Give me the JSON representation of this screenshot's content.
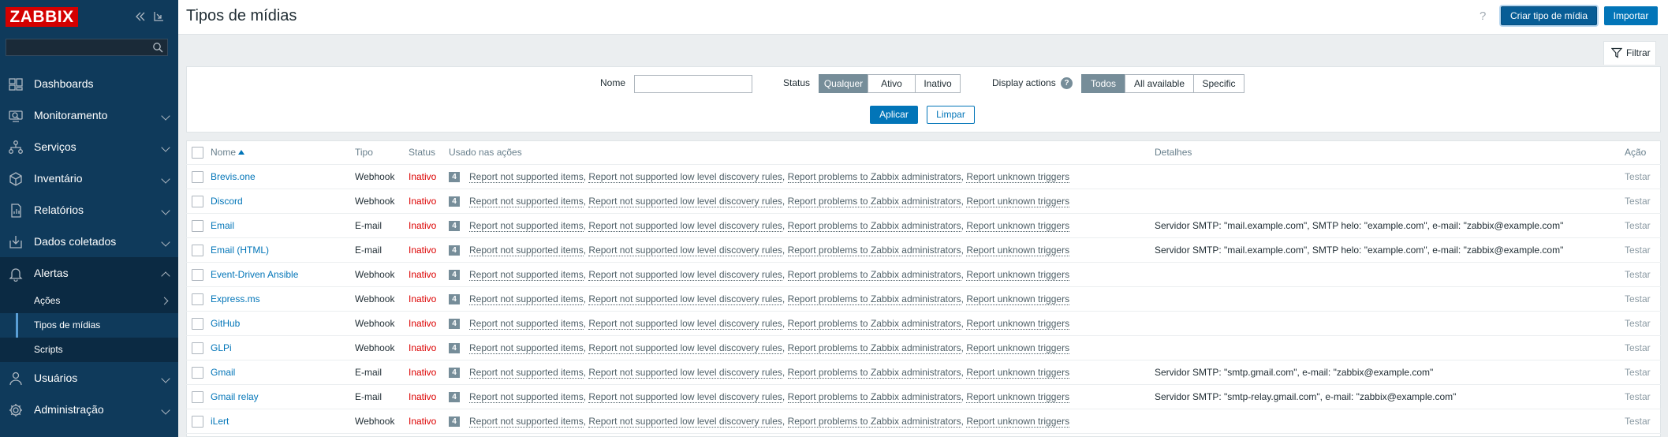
{
  "sidebar": {
    "logo": "ZABBIX",
    "search_placeholder": "",
    "menu": [
      {
        "label": "Dashboards"
      },
      {
        "label": "Monitoramento"
      },
      {
        "label": "Serviços"
      },
      {
        "label": "Inventário"
      },
      {
        "label": "Relatórios"
      },
      {
        "label": "Dados coletados"
      },
      {
        "label": "Alertas"
      },
      {
        "label": "Usuários"
      },
      {
        "label": "Administração"
      }
    ],
    "submenu": [
      {
        "label": "Ações"
      },
      {
        "label": "Tipos de mídias"
      },
      {
        "label": "Scripts"
      }
    ]
  },
  "header": {
    "title": "Tipos de mídias",
    "help": "?",
    "create_button": "Criar tipo de mídia",
    "import_button": "Importar"
  },
  "filter": {
    "tab_label": "Filtrar",
    "name_label": "Nome",
    "name_value": "",
    "status_label": "Status",
    "status_options": [
      "Qualquer",
      "Ativo",
      "Inativo"
    ],
    "status_selected": "Qualquer",
    "display_actions_label": "Display actions",
    "display_actions_help": "?",
    "display_options": [
      "Todos",
      "All available",
      "Specific"
    ],
    "display_selected": "Todos",
    "apply_button": "Aplicar",
    "reset_button": "Limpar"
  },
  "table": {
    "headers": {
      "name": "Nome",
      "type": "Tipo",
      "status": "Status",
      "used_in_actions": "Usado nas ações",
      "details": "Detalhes",
      "action": "Ação"
    },
    "action_links": [
      "Report not supported items",
      "Report not supported low level discovery rules",
      "Report problems to Zabbix administrators",
      "Report unknown triggers"
    ],
    "rows": [
      {
        "name": "Brevis.one",
        "type": "Webhook",
        "status": "Inativo",
        "count": "4",
        "details": "",
        "action": "Testar"
      },
      {
        "name": "Discord",
        "type": "Webhook",
        "status": "Inativo",
        "count": "4",
        "details": "",
        "action": "Testar"
      },
      {
        "name": "Email",
        "type": "E-mail",
        "status": "Inativo",
        "count": "4",
        "details": "Servidor SMTP: \"mail.example.com\", SMTP helo: \"example.com\", e-mail: \"zabbix@example.com\"",
        "action": "Testar"
      },
      {
        "name": "Email (HTML)",
        "type": "E-mail",
        "status": "Inativo",
        "count": "4",
        "details": "Servidor SMTP: \"mail.example.com\", SMTP helo: \"example.com\", e-mail: \"zabbix@example.com\"",
        "action": "Testar"
      },
      {
        "name": "Event-Driven Ansible",
        "type": "Webhook",
        "status": "Inativo",
        "count": "4",
        "details": "",
        "action": "Testar"
      },
      {
        "name": "Express.ms",
        "type": "Webhook",
        "status": "Inativo",
        "count": "4",
        "details": "",
        "action": "Testar"
      },
      {
        "name": "GitHub",
        "type": "Webhook",
        "status": "Inativo",
        "count": "4",
        "details": "",
        "action": "Testar"
      },
      {
        "name": "GLPi",
        "type": "Webhook",
        "status": "Inativo",
        "count": "4",
        "details": "",
        "action": "Testar"
      },
      {
        "name": "Gmail",
        "type": "E-mail",
        "status": "Inativo",
        "count": "4",
        "details": "Servidor SMTP: \"smtp.gmail.com\", e-mail: \"zabbix@example.com\"",
        "action": "Testar"
      },
      {
        "name": "Gmail relay",
        "type": "E-mail",
        "status": "Inativo",
        "count": "4",
        "details": "Servidor SMTP: \"smtp-relay.gmail.com\", e-mail: \"zabbix@example.com\"",
        "action": "Testar"
      },
      {
        "name": "iLert",
        "type": "Webhook",
        "status": "Inativo",
        "count": "4",
        "details": "",
        "action": "Testar"
      }
    ]
  },
  "colors": {
    "sidebar_bg": "#0f3a5b",
    "accent": "#0275b8",
    "inactive": "#dc0000",
    "logo_bg": "#d40000"
  }
}
